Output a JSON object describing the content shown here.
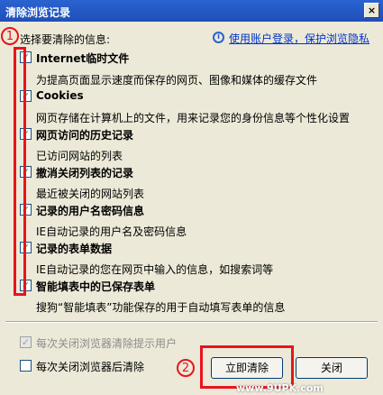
{
  "window": {
    "title": "清除浏览记录",
    "close_glyph": "×"
  },
  "prompt": "选择要清除的信息:",
  "privacy_link": "使用账户登录，保护浏览隐私",
  "items": [
    {
      "title": "Internet临时文件",
      "desc": "为提高页面显示速度而保存的网页、图像和媒体的缓存文件",
      "checked": true
    },
    {
      "title": "Cookies",
      "desc": "网页存储在计算机上的文件，用来记录您的身份信息等个性化设置",
      "checked": true
    },
    {
      "title": "网页访问的历史记录",
      "desc": "已访问网站的列表",
      "checked": true
    },
    {
      "title": "撤消关闭列表的记录",
      "desc": "最近被关闭的网站列表",
      "checked": true
    },
    {
      "title": "记录的用户名密码信息",
      "desc": "IE自动记录的用户名及密码信息",
      "checked": true
    },
    {
      "title": "记录的表单数据",
      "desc": "IE自动记录的您在网页中输入的信息，如搜索词等",
      "checked": true
    },
    {
      "title": "智能填表中的已保存表单",
      "desc": "搜狗“智能填表”功能保存的用于自动填写表单的信息",
      "checked": true
    }
  ],
  "footer": {
    "option1": {
      "label": "每次关闭浏览器清除提示用户",
      "checked": true,
      "disabled": true
    },
    "option2": {
      "label": "每次关闭浏览器后清除",
      "checked": false,
      "disabled": false
    },
    "clear_button": "立即清除",
    "close_button": "关闭"
  },
  "annotations": {
    "marker1": "1",
    "marker2": "2"
  },
  "watermark": "www.9UPK.com",
  "colors": {
    "titlebar": "#1e4fb8",
    "annotation": "#e8141c",
    "check": "#21a121"
  }
}
